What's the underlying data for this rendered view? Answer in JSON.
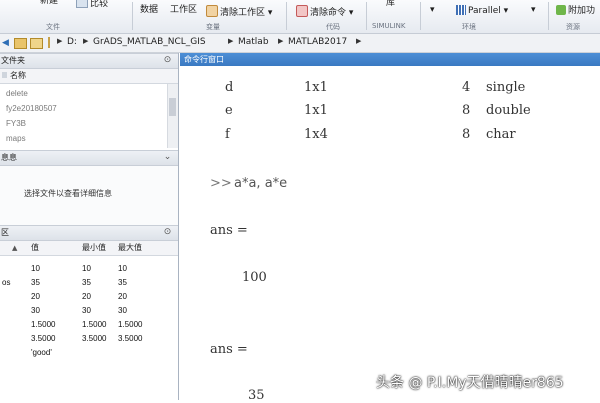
{
  "toolstrip": {
    "items": {
      "new": "新建",
      "compare": "比较",
      "data": "数据",
      "workspace": "工作区",
      "clear_workspace": "清除工作区",
      "clear_commands": "清除命令",
      "library": "库",
      "parallel": "Parallel",
      "addons": "附加功"
    },
    "groups": {
      "file": "文件",
      "variable": "变量",
      "code": "代码",
      "simulink": "SIMULINK",
      "environment": "环境",
      "resources": "资源"
    }
  },
  "addressbar": {
    "path": [
      "D:",
      "GrADS_MATLAB_NCL_GIS",
      "Matlab",
      "MATLAB2017"
    ]
  },
  "current_folder": {
    "title": "文件夹",
    "column_name": "名称",
    "files": [
      "delete",
      "fy2e20180507",
      "FY3B",
      "maps"
    ]
  },
  "details": {
    "title": "息息",
    "message": "选择文件以查看详细信息"
  },
  "workspace": {
    "title": "区",
    "columns": {
      "value": "值",
      "min": "最小值",
      "max": "最大值"
    },
    "rows": [
      {
        "name": "",
        "value": "10",
        "min": "10",
        "max": "10"
      },
      {
        "name": "os",
        "value": "35",
        "min": "35",
        "max": "35"
      },
      {
        "name": "",
        "value": "20",
        "min": "20",
        "max": "20"
      },
      {
        "name": "",
        "value": "30",
        "min": "30",
        "max": "30"
      },
      {
        "name": "",
        "value": "1.5000",
        "min": "1.5000",
        "max": "1.5000"
      },
      {
        "name": "",
        "value": "3.5000",
        "min": "3.5000",
        "max": "3.5000"
      },
      {
        "name": "",
        "value": "'good'",
        "min": "",
        "max": ""
      }
    ]
  },
  "command_window": {
    "title": "命令行窗口",
    "whos_rows": [
      {
        "name": "d",
        "size": "1x1",
        "bytes": "4",
        "class": "single"
      },
      {
        "name": "e",
        "size": "1x1",
        "bytes": "8",
        "class": "double"
      },
      {
        "name": "f",
        "size": "1x4",
        "bytes": "8",
        "class": "char"
      }
    ],
    "prompt": ">>",
    "command": "a*a, a*e",
    "outputs": [
      {
        "label": "ans =",
        "value": "100"
      },
      {
        "label": "ans =",
        "value": "35"
      }
    ]
  },
  "watermark": "头条 @ P.I.My天借晴晴er865"
}
